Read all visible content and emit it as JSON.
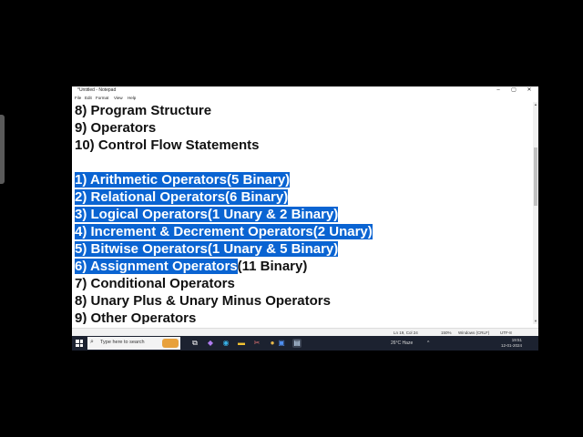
{
  "window": {
    "title": "*Untitled - Notepad",
    "minimize_glyph": "–",
    "maximize_glyph": "▢",
    "close_glyph": "✕"
  },
  "menu": [
    "File",
    "Edit",
    "Format",
    "View",
    "Help"
  ],
  "editor": {
    "lines": [
      {
        "text": "8) Program Structure",
        "selected": ""
      },
      {
        "text": "9) Operators",
        "selected": ""
      },
      {
        "text": "10) Control Flow Statements",
        "selected": ""
      },
      {
        "text": "",
        "selected": ""
      },
      {
        "text": "",
        "selected": "1) Arithmetic Operators(5 Binary)"
      },
      {
        "text": "",
        "selected": "2) Relational Operators(6 Binary)"
      },
      {
        "text": "",
        "selected": "3) Logical Operators(1 Unary & 2 Binary)"
      },
      {
        "text": "",
        "selected": "4) Increment & Decrement Operators(2 Unary)"
      },
      {
        "text": "",
        "selected": "5) Bitwise Operators(1 Unary & 5 Binary)"
      },
      {
        "text": "(11 Binary)",
        "selected": "6) Assignment Operators"
      },
      {
        "text": "7) Conditional Operators",
        "selected": ""
      },
      {
        "text": "8) Unary Plus & Unary Minus Operators",
        "selected": ""
      },
      {
        "text": "9) Other Operators",
        "selected": ""
      }
    ]
  },
  "scrollbar": {
    "up_glyph": "▲",
    "down_glyph": "▼"
  },
  "statusbar": {
    "position": "Ln 19, Col 24",
    "zoom": "150%",
    "line_ending": "Windows (CRLF)",
    "encoding": "UTF-8"
  },
  "taskbar": {
    "start_icon": "windows-logo-icon",
    "search_placeholder": "Type here to search",
    "search_glyph": "⌕",
    "apps": [
      {
        "name": "task-view-icon",
        "glyph": "⧉"
      },
      {
        "name": "visual-studio-icon",
        "glyph": "◆"
      },
      {
        "name": "edge-icon",
        "glyph": "◉"
      },
      {
        "name": "file-explorer-icon",
        "glyph": "▬"
      },
      {
        "name": "snipping-tool-icon",
        "glyph": "✂"
      },
      {
        "name": "chrome-icon",
        "glyph": "●"
      },
      {
        "name": "app-icon",
        "glyph": "▣"
      },
      {
        "name": "notepad-icon",
        "glyph": "▤"
      }
    ],
    "weather": "26°C  Haze",
    "chevron_glyph": "^",
    "time": "19:51",
    "date": "12-01-2024"
  },
  "colors": {
    "selection": "#0a64d2",
    "taskbar": "#1c2230"
  }
}
